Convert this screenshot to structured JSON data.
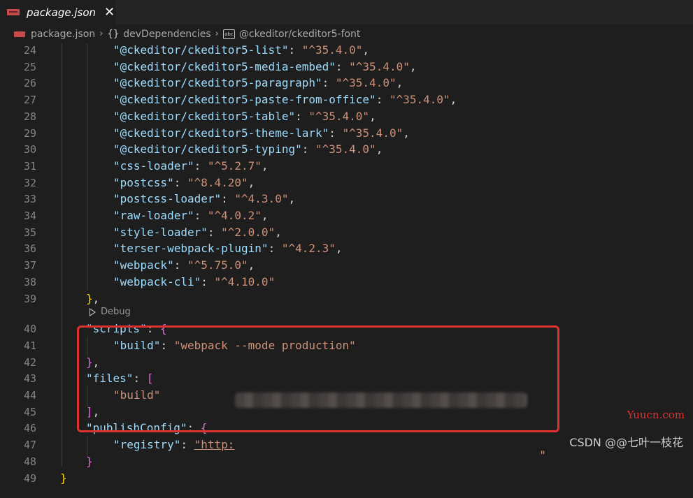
{
  "tab": {
    "title": "package.json",
    "close_label": "✕"
  },
  "breadcrumb": {
    "file": "package.json",
    "section_brace": "{}",
    "section": "devDependencies",
    "abc_icon_label": "abc",
    "item": "@ckeditor/ckeditor5-font",
    "separator": "›"
  },
  "lines": [
    {
      "num": "24",
      "tokens": [
        {
          "t": "\"@ckeditor/ckeditor5-list\"",
          "c": "k"
        },
        {
          "t": ": ",
          "c": "p"
        },
        {
          "t": "\"^35.4.0\"",
          "c": "s"
        },
        {
          "t": ",",
          "c": "p"
        }
      ]
    },
    {
      "num": "25",
      "tokens": [
        {
          "t": "\"@ckeditor/ckeditor5-media-embed\"",
          "c": "k"
        },
        {
          "t": ": ",
          "c": "p"
        },
        {
          "t": "\"^35.4.0\"",
          "c": "s"
        },
        {
          "t": ",",
          "c": "p"
        }
      ]
    },
    {
      "num": "26",
      "tokens": [
        {
          "t": "\"@ckeditor/ckeditor5-paragraph\"",
          "c": "k"
        },
        {
          "t": ": ",
          "c": "p"
        },
        {
          "t": "\"^35.4.0\"",
          "c": "s"
        },
        {
          "t": ",",
          "c": "p"
        }
      ]
    },
    {
      "num": "27",
      "tokens": [
        {
          "t": "\"@ckeditor/ckeditor5-paste-from-office\"",
          "c": "k"
        },
        {
          "t": ": ",
          "c": "p"
        },
        {
          "t": "\"^35.4.0\"",
          "c": "s"
        },
        {
          "t": ",",
          "c": "p"
        }
      ]
    },
    {
      "num": "28",
      "tokens": [
        {
          "t": "\"@ckeditor/ckeditor5-table\"",
          "c": "k"
        },
        {
          "t": ": ",
          "c": "p"
        },
        {
          "t": "\"^35.4.0\"",
          "c": "s"
        },
        {
          "t": ",",
          "c": "p"
        }
      ]
    },
    {
      "num": "29",
      "tokens": [
        {
          "t": "\"@ckeditor/ckeditor5-theme-lark\"",
          "c": "k"
        },
        {
          "t": ": ",
          "c": "p"
        },
        {
          "t": "\"^35.4.0\"",
          "c": "s"
        },
        {
          "t": ",",
          "c": "p"
        }
      ]
    },
    {
      "num": "30",
      "tokens": [
        {
          "t": "\"@ckeditor/ckeditor5-typing\"",
          "c": "k"
        },
        {
          "t": ": ",
          "c": "p"
        },
        {
          "t": "\"^35.4.0\"",
          "c": "s"
        },
        {
          "t": ",",
          "c": "p"
        }
      ]
    },
    {
      "num": "31",
      "tokens": [
        {
          "t": "\"css-loader\"",
          "c": "k"
        },
        {
          "t": ": ",
          "c": "p"
        },
        {
          "t": "\"^5.2.7\"",
          "c": "s"
        },
        {
          "t": ",",
          "c": "p"
        }
      ]
    },
    {
      "num": "32",
      "tokens": [
        {
          "t": "\"postcss\"",
          "c": "k"
        },
        {
          "t": ": ",
          "c": "p"
        },
        {
          "t": "\"^8.4.20\"",
          "c": "s"
        },
        {
          "t": ",",
          "c": "p"
        }
      ]
    },
    {
      "num": "33",
      "tokens": [
        {
          "t": "\"postcss-loader\"",
          "c": "k"
        },
        {
          "t": ": ",
          "c": "p"
        },
        {
          "t": "\"^4.3.0\"",
          "c": "s"
        },
        {
          "t": ",",
          "c": "p"
        }
      ]
    },
    {
      "num": "34",
      "tokens": [
        {
          "t": "\"raw-loader\"",
          "c": "k"
        },
        {
          "t": ": ",
          "c": "p"
        },
        {
          "t": "\"^4.0.2\"",
          "c": "s"
        },
        {
          "t": ",",
          "c": "p"
        }
      ]
    },
    {
      "num": "35",
      "tokens": [
        {
          "t": "\"style-loader\"",
          "c": "k"
        },
        {
          "t": ": ",
          "c": "p"
        },
        {
          "t": "\"^2.0.0\"",
          "c": "s"
        },
        {
          "t": ",",
          "c": "p"
        }
      ]
    },
    {
      "num": "36",
      "tokens": [
        {
          "t": "\"terser-webpack-plugin\"",
          "c": "k"
        },
        {
          "t": ": ",
          "c": "p"
        },
        {
          "t": "\"^4.2.3\"",
          "c": "s"
        },
        {
          "t": ",",
          "c": "p"
        }
      ]
    },
    {
      "num": "37",
      "tokens": [
        {
          "t": "\"webpack\"",
          "c": "k"
        },
        {
          "t": ": ",
          "c": "p"
        },
        {
          "t": "\"^5.75.0\"",
          "c": "s"
        },
        {
          "t": ",",
          "c": "p"
        }
      ]
    },
    {
      "num": "38",
      "tokens": [
        {
          "t": "\"webpack-cli\"",
          "c": "k"
        },
        {
          "t": ": ",
          "c": "p"
        },
        {
          "t": "\"^4.10.0\"",
          "c": "s"
        }
      ]
    },
    {
      "num": "39",
      "tokens": [
        {
          "t": "}",
          "c": "b2"
        },
        {
          "t": ",",
          "c": "p"
        }
      ]
    },
    {
      "num": "40",
      "tokens": [
        {
          "t": "\"scripts\"",
          "c": "k"
        },
        {
          "t": ": ",
          "c": "p"
        },
        {
          "t": "{",
          "c": "b1"
        }
      ]
    },
    {
      "num": "41",
      "tokens": [
        {
          "t": "\"build\"",
          "c": "k"
        },
        {
          "t": ": ",
          "c": "p"
        },
        {
          "t": "\"webpack --mode production\"",
          "c": "s"
        }
      ]
    },
    {
      "num": "42",
      "tokens": [
        {
          "t": "}",
          "c": "b1"
        },
        {
          "t": ",",
          "c": "p"
        }
      ]
    },
    {
      "num": "43",
      "tokens": [
        {
          "t": "\"files\"",
          "c": "k"
        },
        {
          "t": ": ",
          "c": "p"
        },
        {
          "t": "[",
          "c": "b1"
        }
      ]
    },
    {
      "num": "44",
      "tokens": [
        {
          "t": "\"build\"",
          "c": "s"
        }
      ]
    },
    {
      "num": "45",
      "tokens": [
        {
          "t": "]",
          "c": "b1"
        },
        {
          "t": ",",
          "c": "p"
        }
      ]
    },
    {
      "num": "46",
      "tokens": [
        {
          "t": "\"publishConfig\"",
          "c": "k"
        },
        {
          "t": ": ",
          "c": "p"
        },
        {
          "t": "{",
          "c": "b1"
        }
      ]
    },
    {
      "num": "47",
      "tokens": [
        {
          "t": "\"registry\"",
          "c": "k"
        },
        {
          "t": ": ",
          "c": "p"
        },
        {
          "t": "\"http:",
          "c": "s"
        }
      ]
    },
    {
      "num": "48",
      "tokens": [
        {
          "t": "}",
          "c": "b1"
        }
      ]
    },
    {
      "num": "49",
      "tokens": [
        {
          "t": "}",
          "c": "b2"
        }
      ]
    }
  ],
  "codelens": {
    "label": "Debug"
  },
  "registry_tail": "\"",
  "watermarks": {
    "site": "Yuucn.com",
    "csdn": "CSDN @@七叶一枝花"
  },
  "colors": {
    "key": "#9cdcfe",
    "string": "#ce9178",
    "bracket_magenta": "#da70d6",
    "bracket_gold": "#ffd700",
    "highlight_red": "#e03131"
  }
}
